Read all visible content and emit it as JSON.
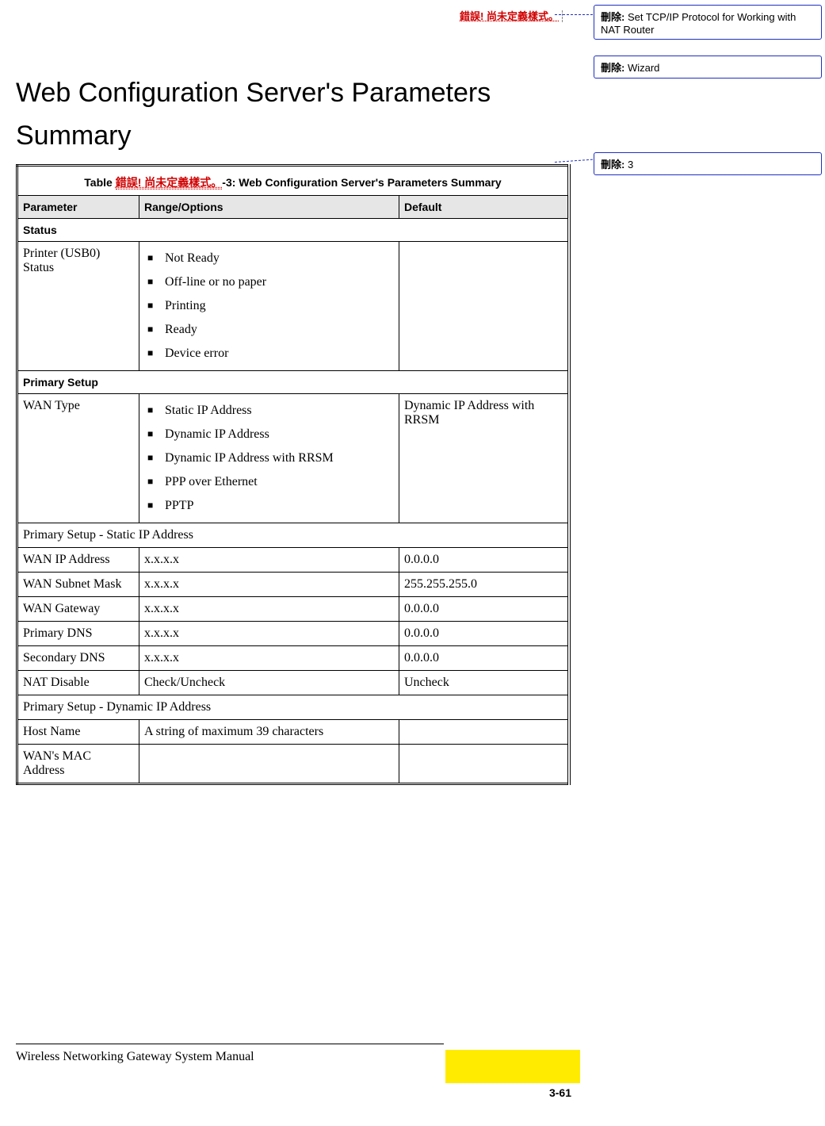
{
  "topError": "錯誤! 尚未定義樣式。",
  "balloons": {
    "b1": {
      "label": "刪除:",
      "text": " Set TCP/IP Protocol for Working with NAT Router"
    },
    "b2": {
      "label": "刪除:",
      "text": " Wizard"
    },
    "b3": {
      "label": "刪除:",
      "text": " 3"
    }
  },
  "title": "Web Configuration Server's Parameters Summary",
  "table": {
    "captionPrefix": "Table ",
    "captionError": "錯誤! 尚未定義樣式。",
    "captionSuffix": "-3: Web Configuration Server's Parameters Summary",
    "headers": {
      "param": "Parameter",
      "range": "Range/Options",
      "default": "Default"
    },
    "statusSection": "Status",
    "printerRow": {
      "param": "Printer (USB0) Status",
      "options": [
        "Not Ready",
        "Off-line or no paper",
        "Printing",
        "Ready",
        "Device error"
      ],
      "default": ""
    },
    "primarySetupSection": "Primary Setup",
    "wanTypeRow": {
      "param": "WAN Type",
      "options": [
        "Static IP Address",
        "Dynamic IP Address",
        "Dynamic IP Address with RRSM",
        "PPP over Ethernet",
        "PPTP"
      ],
      "default": "Dynamic IP Address with RRSM"
    },
    "staticSubheader": "Primary Setup - Static IP Address",
    "staticRows": [
      {
        "param": "WAN IP Address",
        "range": "x.x.x.x",
        "default": "0.0.0.0"
      },
      {
        "param": "WAN Subnet Mask",
        "range": "x.x.x.x",
        "default": "255.255.255.0"
      },
      {
        "param": "WAN Gateway",
        "range": "x.x.x.x",
        "default": "0.0.0.0"
      },
      {
        "param": "Primary DNS",
        "range": "x.x.x.x",
        "default": "0.0.0.0"
      },
      {
        "param": "Secondary DNS",
        "range": "x.x.x.x",
        "default": "0.0.0.0"
      },
      {
        "param": "NAT Disable",
        "range": "Check/Uncheck",
        "default": "Uncheck"
      }
    ],
    "dynamicSubheader": "Primary Setup - Dynamic IP Address",
    "dynamicRows": [
      {
        "param": "Host Name",
        "range": "A string of maximum 39 characters",
        "default": ""
      },
      {
        "param": "WAN's MAC Address",
        "range": "",
        "default": ""
      }
    ]
  },
  "footer": "Wireless Networking Gateway System Manual",
  "pageNumber": "3-61"
}
